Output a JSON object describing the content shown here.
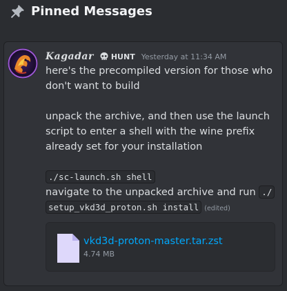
{
  "header": {
    "title": "Pinned Messages",
    "icon": "pin-icon"
  },
  "message": {
    "author": "Kagadar",
    "tag": {
      "icon": "skull-icon",
      "label": "HUNT"
    },
    "timestamp": "Yesterday at 11:34 AM",
    "lines": [
      "here's the precompiled version for those who",
      "don't want to build",
      "unpack the archive, and then use the launch",
      "script to enter a shell with the wine prefix",
      "already set for your installation"
    ],
    "code_command": "./sc-launch.sh shell",
    "navigate_text": "navigate to the unpacked archive and run",
    "code_run_part1": "./",
    "code_run_part2": "setup_vkd3d_proton.sh install",
    "edited_label": "(edited)"
  },
  "attachment": {
    "icon": "file-icon",
    "file_name": "vkd3d-proton-master.tar.zst",
    "file_size": "4.74 MB"
  },
  "colors": {
    "background": "#2b2d31",
    "card": "#313338",
    "link": "#00a8fc",
    "muted": "#949ba4",
    "text": "#dbdee1"
  }
}
